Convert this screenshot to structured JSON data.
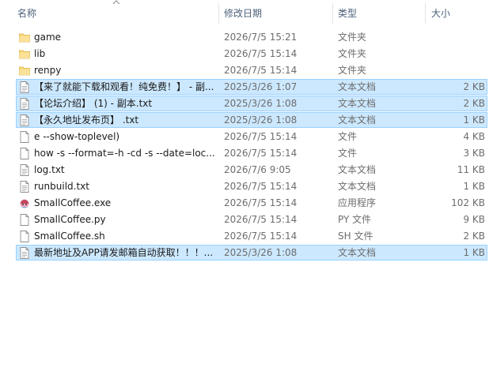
{
  "columns": {
    "name": "名称",
    "date": "修改日期",
    "type": "类型",
    "size": "大小"
  },
  "files": [
    {
      "name": "game",
      "date": "2026/7/5 15:21",
      "type": "文件夹",
      "size": "",
      "icon": "folder-icon",
      "selected": false
    },
    {
      "name": "lib",
      "date": "2026/7/5 15:14",
      "type": "文件夹",
      "size": "",
      "icon": "folder-icon",
      "selected": false
    },
    {
      "name": "renpy",
      "date": "2026/7/5 15:14",
      "type": "文件夹",
      "size": "",
      "icon": "folder-icon",
      "selected": false
    },
    {
      "name": "【来了就能下载和观看！纯免费！】 - 副...",
      "date": "2025/3/26 1:07",
      "type": "文本文档",
      "size": "2 KB",
      "icon": "text-file-icon",
      "selected": true
    },
    {
      "name": "【论坛介绍】 (1) - 副本.txt",
      "date": "2025/3/26 1:08",
      "type": "文本文档",
      "size": "2 KB",
      "icon": "text-file-icon",
      "selected": true
    },
    {
      "name": "【永久地址发布页】 .txt",
      "date": "2025/3/26 1:08",
      "type": "文本文档",
      "size": "1 KB",
      "icon": "text-file-icon",
      "selected": true
    },
    {
      "name": "e --show-toplevel)",
      "date": "2026/7/5 15:14",
      "type": "文件",
      "size": "4 KB",
      "icon": "file-icon",
      "selected": false
    },
    {
      "name": "how -s --format=-h -cd -s --date=loc...",
      "date": "2026/7/5 15:14",
      "type": "文件",
      "size": "3 KB",
      "icon": "file-icon",
      "selected": false
    },
    {
      "name": "log.txt",
      "date": "2026/7/6 9:05",
      "type": "文本文档",
      "size": "11 KB",
      "icon": "text-file-icon",
      "selected": false
    },
    {
      "name": "runbuild.txt",
      "date": "2026/7/5 15:14",
      "type": "文本文档",
      "size": "1 KB",
      "icon": "text-file-icon",
      "selected": false
    },
    {
      "name": "SmallCoffee.exe",
      "date": "2026/7/5 15:14",
      "type": "应用程序",
      "size": "102 KB",
      "icon": "app-icon",
      "selected": false
    },
    {
      "name": "SmallCoffee.py",
      "date": "2026/7/5 15:14",
      "type": "PY 文件",
      "size": "9 KB",
      "icon": "file-icon",
      "selected": false
    },
    {
      "name": "SmallCoffee.sh",
      "date": "2026/7/5 15:14",
      "type": "SH 文件",
      "size": "2 KB",
      "icon": "file-icon",
      "selected": false
    },
    {
      "name": "最新地址及APP请发邮箱自动获取！！！...",
      "date": "2025/3/26 1:08",
      "type": "文本文档",
      "size": "1 KB",
      "icon": "text-file-icon",
      "selected": true
    }
  ],
  "colors": {
    "selection_bg": "#cce8ff",
    "selection_border": "#99d1ff",
    "folder": "#f8d775",
    "header_text": "#4c607a"
  }
}
